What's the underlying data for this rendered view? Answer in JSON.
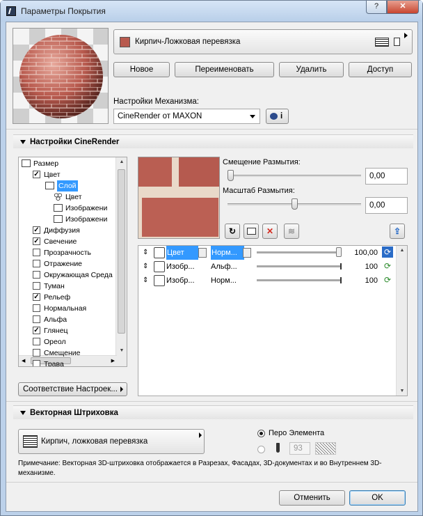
{
  "window": {
    "title": "Параметры Покрытия",
    "help": "?",
    "close": "✕"
  },
  "surface": {
    "name": "Кирпич-Ложковая перевязка",
    "color": "#b85a4e",
    "buttons": {
      "new": "Новое",
      "rename": "Переименовать",
      "delete": "Удалить",
      "access": "Доступ"
    },
    "engine_label": "Настройки Механизма:",
    "engine_value": "CineRender от MAXON",
    "info": "i"
  },
  "cinerender": {
    "header": "Настройки CineRender",
    "tree": [
      {
        "label": "Размер",
        "icon": "size-icon",
        "check": null
      },
      {
        "label": "Цвет",
        "check": true
      },
      {
        "label": "Слой",
        "icon": "layer-icon",
        "selected": true
      },
      {
        "label": "Цвет",
        "icon": "shader-icon"
      },
      {
        "label": "Изображени",
        "icon": "image-icon"
      },
      {
        "label": "Изображени",
        "icon": "image-icon"
      },
      {
        "label": "Диффузия",
        "check": true
      },
      {
        "label": "Свечение",
        "check": true
      },
      {
        "label": "Прозрачность",
        "check": false
      },
      {
        "label": "Отражение",
        "check": false
      },
      {
        "label": "Окружающая Среда",
        "check": false
      },
      {
        "label": "Туман",
        "check": false
      },
      {
        "label": "Рельеф",
        "check": true
      },
      {
        "label": "Нормальная",
        "check": false
      },
      {
        "label": "Альфа",
        "check": false
      },
      {
        "label": "Глянец",
        "check": true
      },
      {
        "label": "Ореол",
        "check": false
      },
      {
        "label": "Смещение",
        "check": false
      },
      {
        "label": "Трава",
        "check": false
      }
    ],
    "match_settings": "Соответствие Настроек...",
    "blur_offset_label": "Смещение Размытия:",
    "blur_offset_value": "0,00",
    "blur_offset_level": 0.0,
    "blur_scale_label": "Масштаб Размытия:",
    "blur_scale_value": "0,00",
    "blur_scale_level": 0.5,
    "layers": [
      {
        "name": "Цвет",
        "mode": "Норм...",
        "value": "100,00",
        "selected": true,
        "icon": "shader-icon",
        "level": 1.0
      },
      {
        "name": "Изобр...",
        "mode": "Альф...",
        "value": "100",
        "icon": "image-icon",
        "level": 1.0
      },
      {
        "name": "Изобр...",
        "mode": "Норм...",
        "value": "100",
        "icon": "image-icon",
        "level": 1.0
      }
    ]
  },
  "vector_hatch": {
    "header": "Векторная Штриховка",
    "pattern": "Кирпич, ложковая перевязка",
    "pen_element": "Перо Элемента",
    "pen_number": "93",
    "note": "Примечание: Векторная 3D-штриховка отображается в Разрезах, Фасадах, 3D-документах и во Внутреннем 3D-механизме."
  },
  "footer": {
    "cancel": "Отменить",
    "ok": "OK"
  }
}
